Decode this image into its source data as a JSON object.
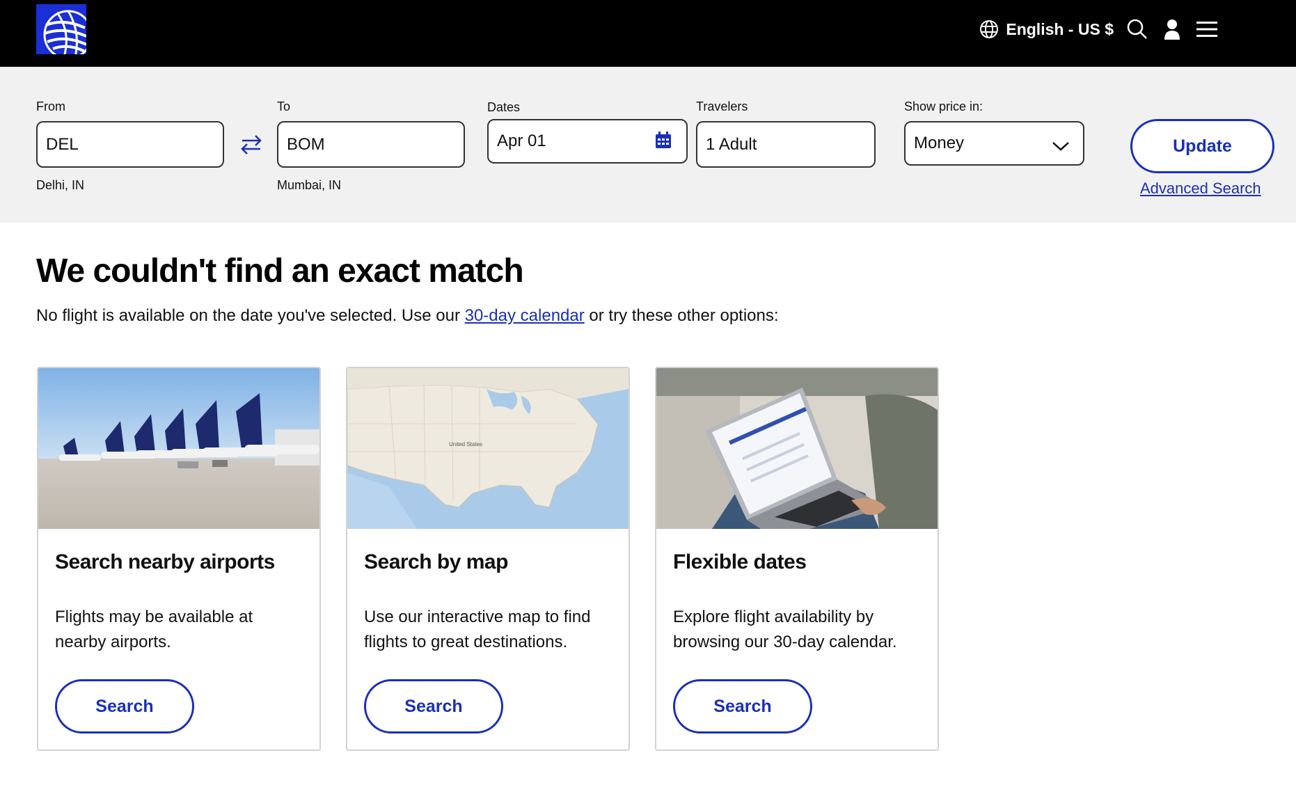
{
  "header": {
    "language_label": "English - US $",
    "logo_icon": "globe-logo-icon",
    "icons": [
      "globe-icon",
      "search-icon",
      "user-icon",
      "menu-icon"
    ]
  },
  "search_form": {
    "from": {
      "label": "From",
      "value": "DEL",
      "sublabel": "Delhi, IN"
    },
    "to": {
      "label": "To",
      "value": "BOM",
      "sublabel": "Mumbai, IN"
    },
    "dates": {
      "label": "Dates",
      "value": "Apr 01"
    },
    "travelers": {
      "label": "Travelers",
      "value": "1 Adult"
    },
    "price": {
      "label": "Show price in:",
      "value": "Money"
    },
    "update_label": "Update",
    "advanced_search_label": "Advanced Search"
  },
  "main": {
    "title": "We couldn't find an exact match",
    "description_prefix": "No flight is available on the date you've selected. Use our ",
    "description_link": "30-day calendar",
    "description_suffix": " or try these other options:"
  },
  "cards": [
    {
      "title": "Search nearby airports",
      "text": "Flights may be available at nearby airports.",
      "button": "Search"
    },
    {
      "title": "Search by map",
      "text": "Use our interactive map to find flights to great destinations.",
      "button": "Search",
      "map_label": "United States"
    },
    {
      "title": "Flexible dates",
      "text": "Explore flight availability by browsing our 30-day calendar.",
      "button": "Search"
    }
  ],
  "colors": {
    "brand_blue": "#1a2fb8",
    "header_bg": "#000000",
    "band_bg": "#f1f1f1"
  }
}
